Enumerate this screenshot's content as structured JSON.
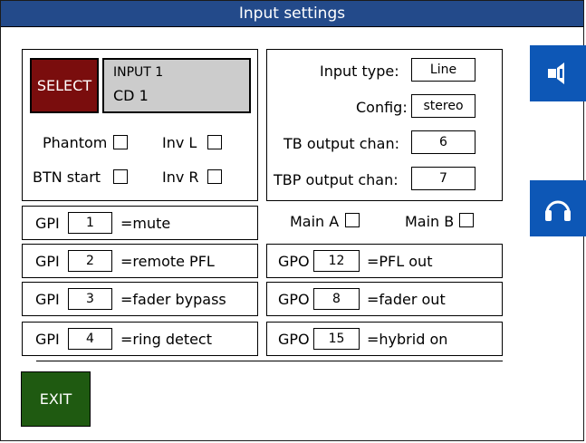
{
  "window": {
    "title": "Input settings"
  },
  "input": {
    "select_label": "SELECT",
    "name": "INPUT 1",
    "source": "CD 1"
  },
  "flags": {
    "phantom_label": "Phantom",
    "inv_l_label": "Inv L",
    "btn_start_label": "BTN start",
    "inv_r_label": "Inv R"
  },
  "settings": {
    "input_type_label": "Input type:",
    "input_type_value": "Line",
    "config_label": "Config:",
    "config_value": "stereo",
    "tb_output_label": "TB output chan:",
    "tb_output_value": "6",
    "tbp_output_label": "TBP output chan:",
    "tbp_output_value": "7"
  },
  "main": {
    "a_label": "Main A",
    "b_label": "Main B"
  },
  "gpi": [
    {
      "prefix": "GPI",
      "value": "1",
      "function": "=mute"
    },
    {
      "prefix": "GPI",
      "value": "2",
      "function": "=remote PFL"
    },
    {
      "prefix": "GPI",
      "value": "3",
      "function": "=fader bypass"
    },
    {
      "prefix": "GPI",
      "value": "4",
      "function": "=ring detect"
    }
  ],
  "gpo": [
    {
      "prefix": "GPO",
      "value": "12",
      "function": "=PFL out"
    },
    {
      "prefix": "GPO",
      "value": "8",
      "function": "=fader out"
    },
    {
      "prefix": "GPO",
      "value": "15",
      "function": "=hybrid on"
    }
  ],
  "exit_label": "EXIT",
  "icons": {
    "top_side": "speaker-icon",
    "bottom_side": "headphones-icon"
  },
  "colors": {
    "titlebar": "#234a8a",
    "select": "#7a0d0d",
    "input_panel": "#cccccc",
    "side_buttons": "#0d57b6",
    "exit": "#1f5a11"
  }
}
